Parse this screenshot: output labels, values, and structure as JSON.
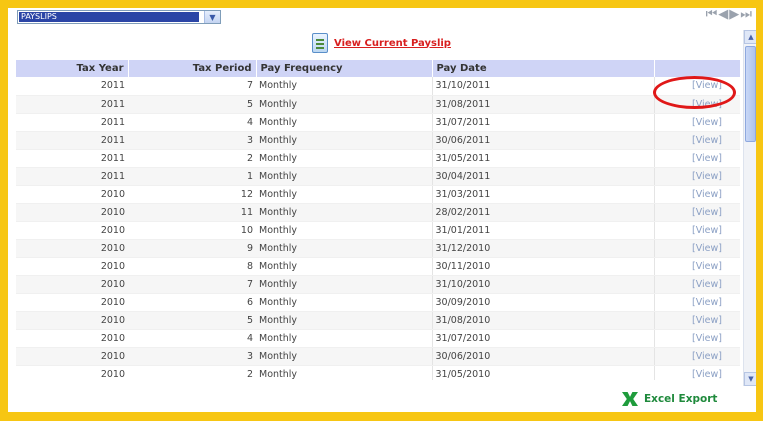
{
  "toolbar": {
    "section_select": "PAYSLIPS",
    "pager": [
      "⏮",
      "◀",
      "▶",
      "⏭"
    ]
  },
  "links": {
    "view_current": "View Current Payslip",
    "excel_export": "Excel Export"
  },
  "table": {
    "headers": [
      "Tax Year",
      "Tax Period",
      "Pay Frequency",
      "Pay Date",
      ""
    ],
    "rows": [
      {
        "year": "2011",
        "period": "7",
        "freq": "Monthly",
        "date": "31/10/2011",
        "action": "[View]"
      },
      {
        "year": "2011",
        "period": "5",
        "freq": "Monthly",
        "date": "31/08/2011",
        "action": "[View]"
      },
      {
        "year": "2011",
        "period": "4",
        "freq": "Monthly",
        "date": "31/07/2011",
        "action": "[View]"
      },
      {
        "year": "2011",
        "period": "3",
        "freq": "Monthly",
        "date": "30/06/2011",
        "action": "[View]"
      },
      {
        "year": "2011",
        "period": "2",
        "freq": "Monthly",
        "date": "31/05/2011",
        "action": "[View]"
      },
      {
        "year": "2011",
        "period": "1",
        "freq": "Monthly",
        "date": "30/04/2011",
        "action": "[View]"
      },
      {
        "year": "2010",
        "period": "12",
        "freq": "Monthly",
        "date": "31/03/2011",
        "action": "[View]"
      },
      {
        "year": "2010",
        "period": "11",
        "freq": "Monthly",
        "date": "28/02/2011",
        "action": "[View]"
      },
      {
        "year": "2010",
        "period": "10",
        "freq": "Monthly",
        "date": "31/01/2011",
        "action": "[View]"
      },
      {
        "year": "2010",
        "period": "9",
        "freq": "Monthly",
        "date": "31/12/2010",
        "action": "[View]"
      },
      {
        "year": "2010",
        "period": "8",
        "freq": "Monthly",
        "date": "30/11/2010",
        "action": "[View]"
      },
      {
        "year": "2010",
        "period": "7",
        "freq": "Monthly",
        "date": "31/10/2010",
        "action": "[View]"
      },
      {
        "year": "2010",
        "period": "6",
        "freq": "Monthly",
        "date": "30/09/2010",
        "action": "[View]"
      },
      {
        "year": "2010",
        "period": "5",
        "freq": "Monthly",
        "date": "31/08/2010",
        "action": "[View]"
      },
      {
        "year": "2010",
        "period": "4",
        "freq": "Monthly",
        "date": "31/07/2010",
        "action": "[View]"
      },
      {
        "year": "2010",
        "period": "3",
        "freq": "Monthly",
        "date": "30/06/2010",
        "action": "[View]"
      },
      {
        "year": "2010",
        "period": "2",
        "freq": "Monthly",
        "date": "31/05/2010",
        "action": "[View]"
      }
    ]
  },
  "colors": {
    "frame": "#f7c613",
    "header_bg": "#cfd4f6",
    "link_red": "#d81e1e",
    "view_link": "#8a9fc4",
    "excel_green": "#1f8a3c",
    "annotation": "#e01818"
  },
  "icons": {
    "current_payslip": "payslip-document-icon",
    "excel": "excel-icon"
  }
}
